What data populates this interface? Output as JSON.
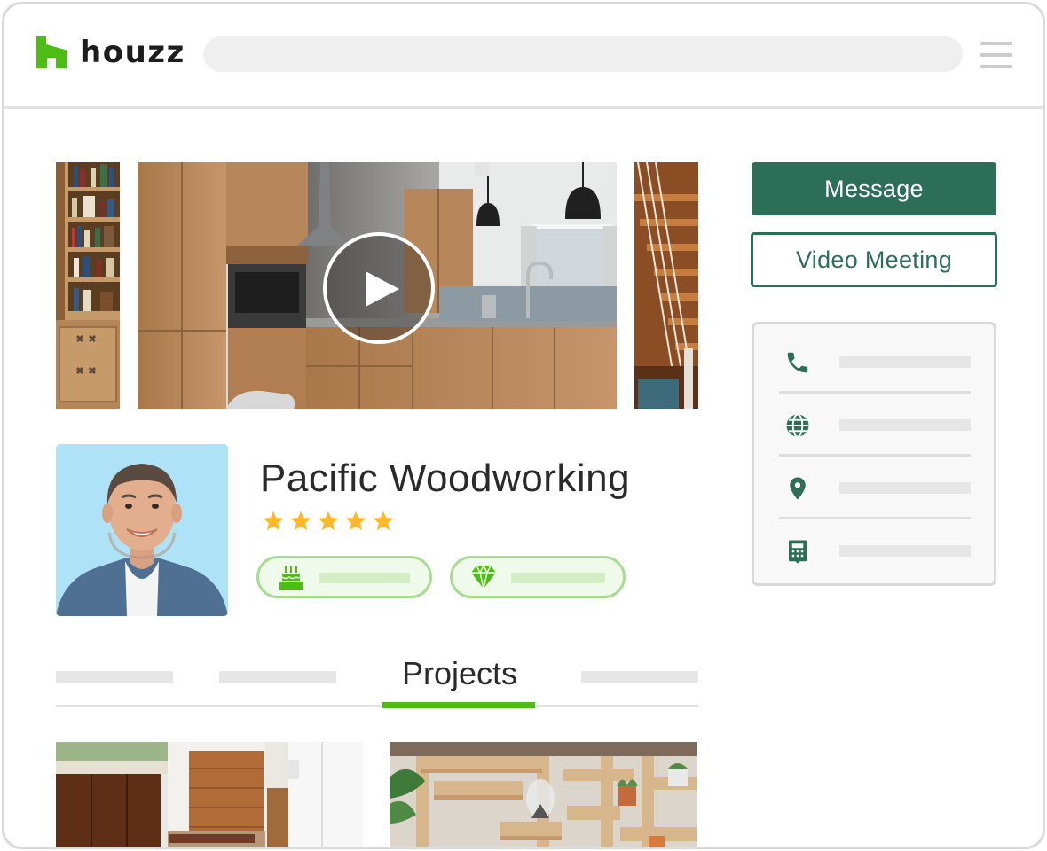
{
  "brand": {
    "name": "houzz",
    "green": "#4dbc15"
  },
  "header": {
    "search_placeholder": "",
    "menu_icon": "hamburger-icon"
  },
  "media": {
    "main": "kitchen-video-thumbnail",
    "play_icon": "play-icon"
  },
  "profile": {
    "name": "Pacific Woodworking",
    "rating": 5,
    "rating_max": 5,
    "star_color": "#ffb82b",
    "badges": [
      {
        "icon": "cake-icon"
      },
      {
        "icon": "diamond-icon"
      }
    ]
  },
  "tabs": {
    "active_label": "Projects"
  },
  "actions": {
    "message_label": "Message",
    "video_meeting_label": "Video Meeting",
    "accent": "#2c6e58"
  },
  "contact": {
    "items": [
      {
        "icon": "phone-icon"
      },
      {
        "icon": "globe-icon"
      },
      {
        "icon": "location-pin-icon"
      },
      {
        "icon": "calculator-icon"
      }
    ]
  }
}
